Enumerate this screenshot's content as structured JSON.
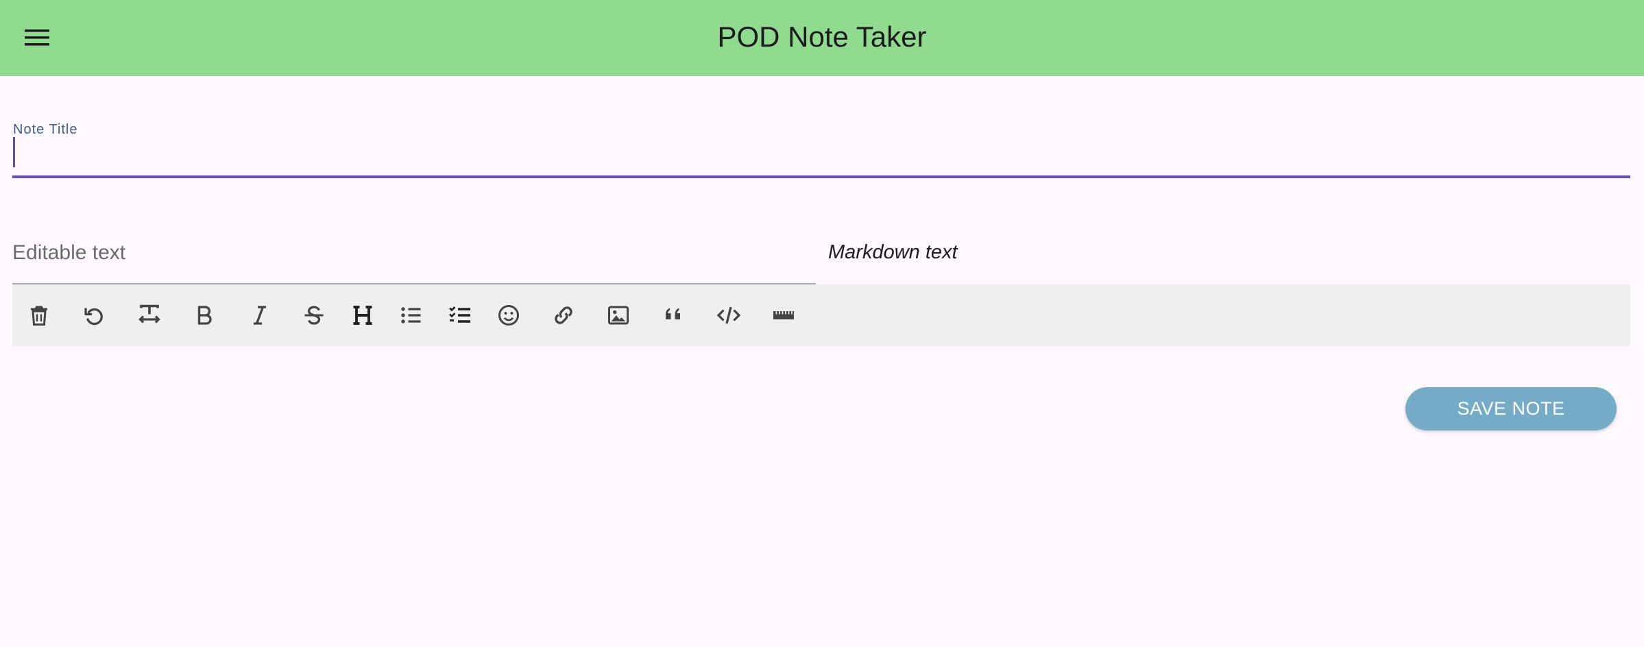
{
  "appbar": {
    "title": "POD Note Taker",
    "color": "#90db90",
    "menu_icon": "menu-icon"
  },
  "note_title": {
    "label": "Note Title",
    "value": "",
    "accent": "#6250a6"
  },
  "editor": {
    "placeholder": "Editable text",
    "preview_label": "Markdown text"
  },
  "toolbar": {
    "icons": [
      "trash-icon",
      "undo-icon",
      "text-width-icon",
      "bold-icon",
      "italic-icon",
      "strikethrough-icon",
      "heading-icon",
      "bullet-list-icon",
      "checklist-icon",
      "emoji-icon",
      "link-icon",
      "image-icon",
      "quote-icon",
      "code-icon",
      "ruler-icon"
    ]
  },
  "actions": {
    "save_label": "SAVE NOTE",
    "save_color": "#76abc8"
  }
}
